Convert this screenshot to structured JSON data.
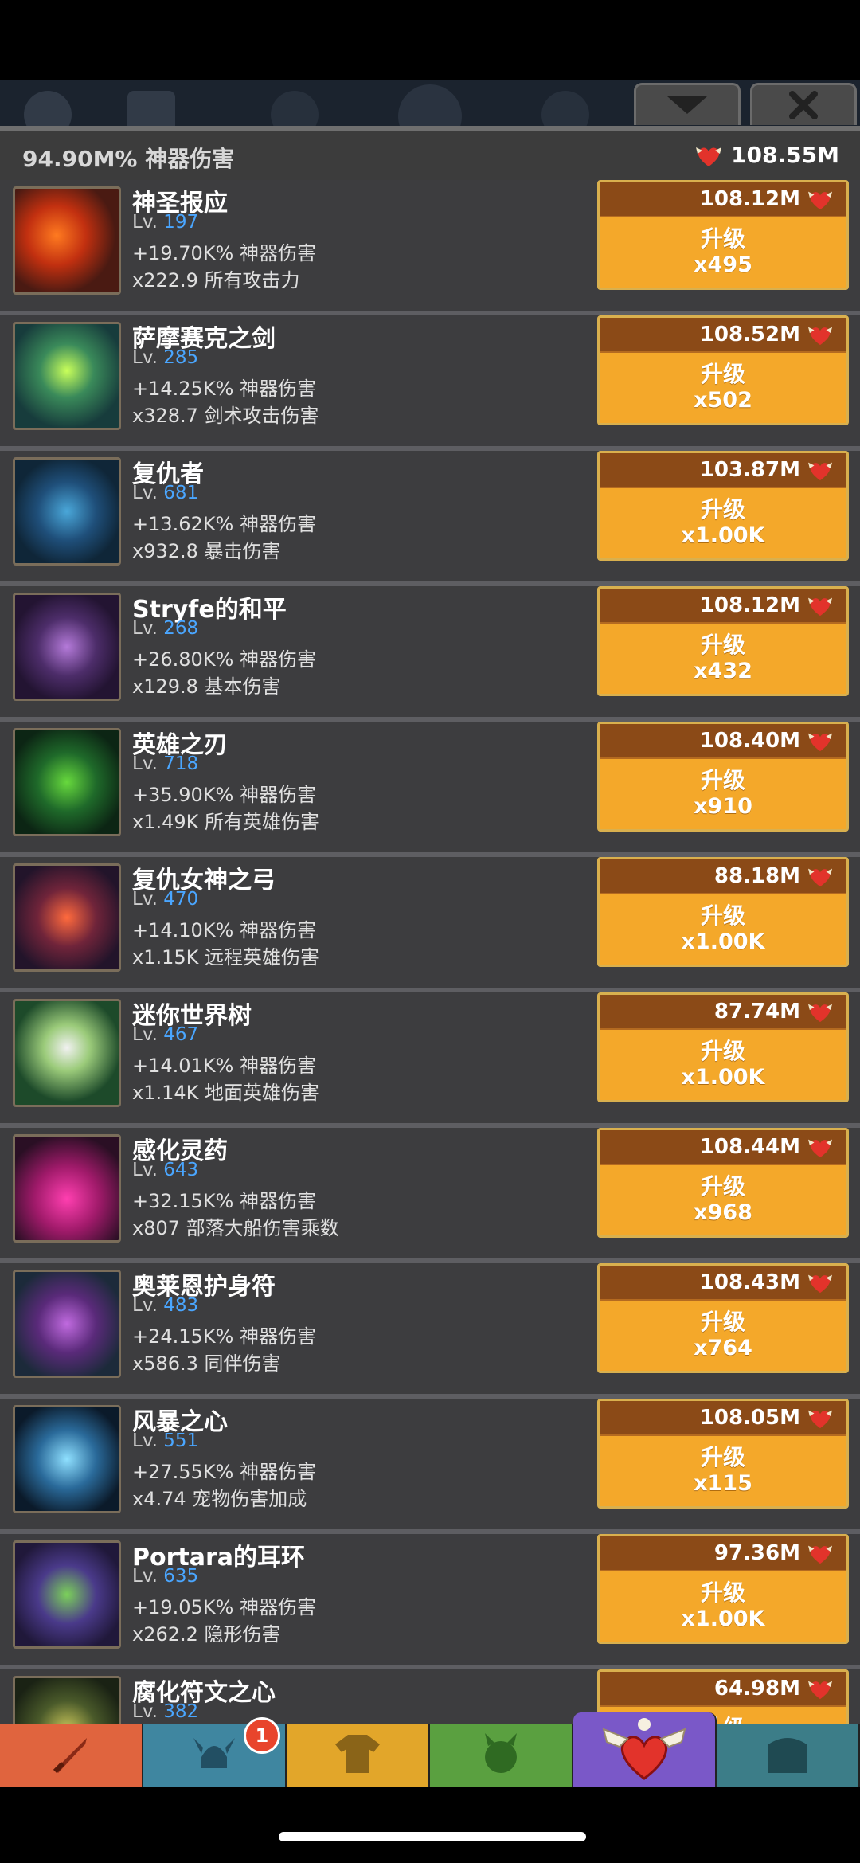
{
  "header": {
    "artifact_damage": "94.90M% 神器伤害",
    "relic_total": "108.55M"
  },
  "items": [
    {
      "name": "神圣报应",
      "lv_prefix": "Lv.",
      "level": "197",
      "stat1": "+19.70K% 神器伤害",
      "stat2": "x222.9 所有攻击力",
      "cost": "108.12M",
      "upgrade": "升级",
      "multiplier": "x495",
      "thumb": "flame-sword-icon"
    },
    {
      "name": "萨摩赛克之剑",
      "lv_prefix": "Lv.",
      "level": "285",
      "stat1": "+14.25K% 神器伤害",
      "stat2": "x328.7 剑术攻击伤害",
      "cost": "108.52M",
      "upgrade": "升级",
      "multiplier": "x502",
      "thumb": "green-sword-icon"
    },
    {
      "name": "复仇者",
      "lv_prefix": "Lv.",
      "level": "681",
      "stat1": "+13.62K% 神器伤害",
      "stat2": "x932.8 暴击伤害",
      "cost": "103.87M",
      "upgrade": "升级",
      "multiplier": "x1.00K",
      "thumb": "blue-blade-icon"
    },
    {
      "name": "Stryfe的和平",
      "lv_prefix": "Lv.",
      "level": "268",
      "stat1": "+26.80K% 神器伤害",
      "stat2": "x129.8 基本伤害",
      "cost": "108.12M",
      "upgrade": "升级",
      "multiplier": "x432",
      "thumb": "winged-dagger-icon"
    },
    {
      "name": "英雄之刃",
      "lv_prefix": "Lv.",
      "level": "718",
      "stat1": "+35.90K% 神器伤害",
      "stat2": "x1.49K 所有英雄伤害",
      "cost": "108.40M",
      "upgrade": "升级",
      "multiplier": "x910",
      "thumb": "hero-blade-icon"
    },
    {
      "name": "复仇女神之弓",
      "lv_prefix": "Lv.",
      "level": "470",
      "stat1": "+14.10K% 神器伤害",
      "stat2": "x1.15K 远程英雄伤害",
      "cost": "88.18M",
      "upgrade": "升级",
      "multiplier": "x1.00K",
      "thumb": "bow-icon"
    },
    {
      "name": "迷你世界树",
      "lv_prefix": "Lv.",
      "level": "467",
      "stat1": "+14.01K% 神器伤害",
      "stat2": "x1.14K 地面英雄伤害",
      "cost": "87.74M",
      "upgrade": "升级",
      "multiplier": "x1.00K",
      "thumb": "tree-icon"
    },
    {
      "name": "感化灵药",
      "lv_prefix": "Lv.",
      "level": "643",
      "stat1": "+32.15K% 神器伤害",
      "stat2": "x807 部落大船伤害乘数",
      "cost": "108.44M",
      "upgrade": "升级",
      "multiplier": "x968",
      "thumb": "potion-icon"
    },
    {
      "name": "奥莱恩护身符",
      "lv_prefix": "Lv.",
      "level": "483",
      "stat1": "+24.15K% 神器伤害",
      "stat2": "x586.3 同伴伤害",
      "cost": "108.43M",
      "upgrade": "升级",
      "multiplier": "x764",
      "thumb": "amulet-icon"
    },
    {
      "name": "风暴之心",
      "lv_prefix": "Lv.",
      "level": "551",
      "stat1": "+27.55K% 神器伤害",
      "stat2": "x4.74 宠物伤害加成",
      "cost": "108.05M",
      "upgrade": "升级",
      "multiplier": "x115",
      "thumb": "storm-orb-icon"
    },
    {
      "name": "Portara的耳环",
      "lv_prefix": "Lv.",
      "level": "635",
      "stat1": "+19.05K% 神器伤害",
      "stat2": "x262.2 隐形伤害",
      "cost": "97.36M",
      "upgrade": "升级",
      "multiplier": "x1.00K",
      "thumb": "earring-icon"
    },
    {
      "name": "腐化符文之心",
      "lv_prefix": "Lv.",
      "level": "382",
      "stat1": "",
      "stat2": "",
      "cost": "64.98M",
      "upgrade": "升级",
      "multiplier": "",
      "thumb": "rune-heart-icon"
    }
  ],
  "nav": {
    "tabs": [
      {
        "icon": "sword-icon",
        "color": "#e0643e"
      },
      {
        "icon": "viking-helmet-icon",
        "color": "#3f86a0",
        "badge": "1"
      },
      {
        "icon": "shirt-icon",
        "color": "#e2a62a"
      },
      {
        "icon": "pet-icon",
        "color": "#5aa040"
      },
      {
        "icon": "winged-heart-icon",
        "color": "#7a58c8",
        "active": true
      },
      {
        "icon": "chest-icon",
        "color": "#3c7d88"
      }
    ]
  }
}
